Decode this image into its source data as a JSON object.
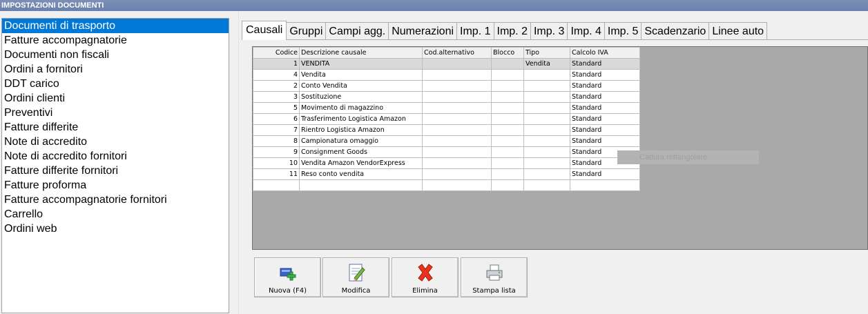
{
  "window": {
    "title": "IMPOSTAZIONI DOCUMENTI"
  },
  "sidebar": {
    "items": [
      "Documenti di trasporto",
      "Fatture accompagnatorie",
      "Documenti non fiscali",
      "Ordini a fornitori",
      "DDT carico",
      "Ordini clienti",
      "Preventivi",
      "Fatture differite",
      "Note di accredito",
      "Note di accredito fornitori",
      "Fatture differite fornitori",
      "Fatture proforma",
      "Fatture accompagnatorie fornitori",
      "Carrello",
      "Ordini web"
    ],
    "selected_index": 0
  },
  "tabs": [
    "Causali",
    "Gruppi",
    "Campi agg.",
    "Numerazioni",
    "Imp. 1",
    "Imp. 2",
    "Imp. 3",
    "Imp. 4",
    "Imp. 5",
    "Scadenzario",
    "Linee auto"
  ],
  "active_tab": 0,
  "table": {
    "columns": [
      "Codice",
      "Descrizione causale",
      "Cod.alternativo",
      "Blocco",
      "Tipo",
      "Calcolo IVA"
    ],
    "rows": [
      [
        "1",
        "VENDITA",
        "",
        "",
        "Vendita",
        "Standard"
      ],
      [
        "4",
        "Vendita",
        "",
        "",
        "",
        "Standard"
      ],
      [
        "2",
        "Conto Vendita",
        "",
        "",
        "",
        "Standard"
      ],
      [
        "3",
        "Sostituzione",
        "",
        "",
        "",
        "Standard"
      ],
      [
        "5",
        "Movimento di magazzino",
        "",
        "",
        "",
        "Standard"
      ],
      [
        "6",
        "Trasferimento Logistica Amazon",
        "",
        "",
        "",
        "Standard"
      ],
      [
        "7",
        "Rientro Logistica Amazon",
        "",
        "",
        "",
        "Standard"
      ],
      [
        "8",
        "Campionatura omaggio",
        "",
        "",
        "",
        "Standard"
      ],
      [
        "9",
        "Consignment Goods",
        "",
        "",
        "",
        "Standard"
      ],
      [
        "10",
        "Vendita Amazon VendorExpress",
        "",
        "",
        "",
        "Standard"
      ],
      [
        "11",
        "Reso conto vendita",
        "",
        "",
        "",
        "Standard"
      ],
      [
        "",
        "",
        "",
        "",
        "",
        ""
      ]
    ],
    "selected_row": 0
  },
  "ghost_tooltip": "Cattura rettangolare",
  "buttons": {
    "new_label": "Nuova (F4)",
    "edit_label": "Modifica",
    "delete_label": "Elimina",
    "print_label": "Stampa lista"
  },
  "colors": {
    "selection": "#0078d7",
    "titlebar": "#6a80ad",
    "panel": "#a9a9a9"
  },
  "icons": {
    "new": "new-document-plus-icon",
    "edit": "edit-document-icon",
    "delete": "red-x-icon",
    "print": "printer-icon"
  }
}
